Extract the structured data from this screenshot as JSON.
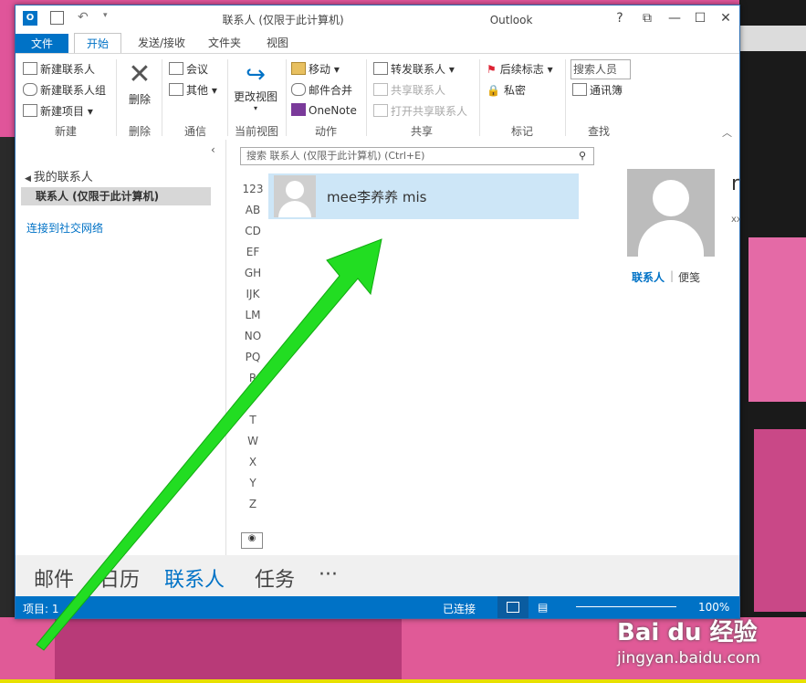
{
  "titlebar": {
    "title": "联系人 (仅限于此计算机)",
    "title_suffix": "Outlook",
    "help": "?",
    "restore_ribbon": "⧉",
    "minimize": "—",
    "maximize": "☐",
    "close": "✕",
    "undo_icon": "undo-icon"
  },
  "tabs": [
    "文件",
    "开始",
    "发送/接收",
    "文件夹",
    "视图"
  ],
  "ribbon": {
    "new_contact": "新建联系人",
    "new_contact_group": "新建联系人组",
    "new_items": "新建项目",
    "delete": "删除",
    "meeting": "会议",
    "more": "其他",
    "change_view": "更改视图",
    "move": "移动",
    "mail_merge": "邮件合并",
    "onenote": "OneNote",
    "forward_contact": "转发联系人",
    "share_contacts": "共享联系人",
    "open_shared_contacts": "打开共享联系人",
    "follow_up": "后续标志",
    "private": "私密",
    "search_people_placeholder": "搜索人员",
    "address_book": "通讯簿",
    "groups": {
      "new": "新建",
      "delete": "删除",
      "communicate": "通信",
      "current_view": "当前视图",
      "actions": "动作",
      "share": "共享",
      "tags": "标记",
      "find": "查找"
    }
  },
  "nav": {
    "my_contacts": "我的联系人",
    "contacts_folder": "联系人 (仅限于此计算机)",
    "connect_social": "连接到社交网络"
  },
  "search": {
    "placeholder": "搜索 联系人 (仅限于此计算机) (Ctrl+E)"
  },
  "letters": [
    "123",
    "AB",
    "CD",
    "EF",
    "GH",
    "IJK",
    "LM",
    "NO",
    "PQ",
    "R",
    "",
    "T",
    "W",
    "X",
    "Y",
    "Z"
  ],
  "contact": {
    "name": "mee李养养 mis"
  },
  "reading": {
    "tab_contact": "联系人",
    "tab_notes": "便笺",
    "name_initial": "r",
    "sub": "xx"
  },
  "bottomnav": {
    "mail": "邮件",
    "calendar": "日历",
    "people": "联系人",
    "tasks": "任务",
    "more": "···"
  },
  "status": {
    "items": "项目: 1",
    "connected": "已连接",
    "zoom": "100%"
  },
  "colors": {
    "accent": "#0072c6",
    "selection": "#cde6f7",
    "arrow": "#22dd22"
  },
  "watermark": {
    "brand": "Bai du 经验",
    "url": "jingyan.baidu.com"
  }
}
